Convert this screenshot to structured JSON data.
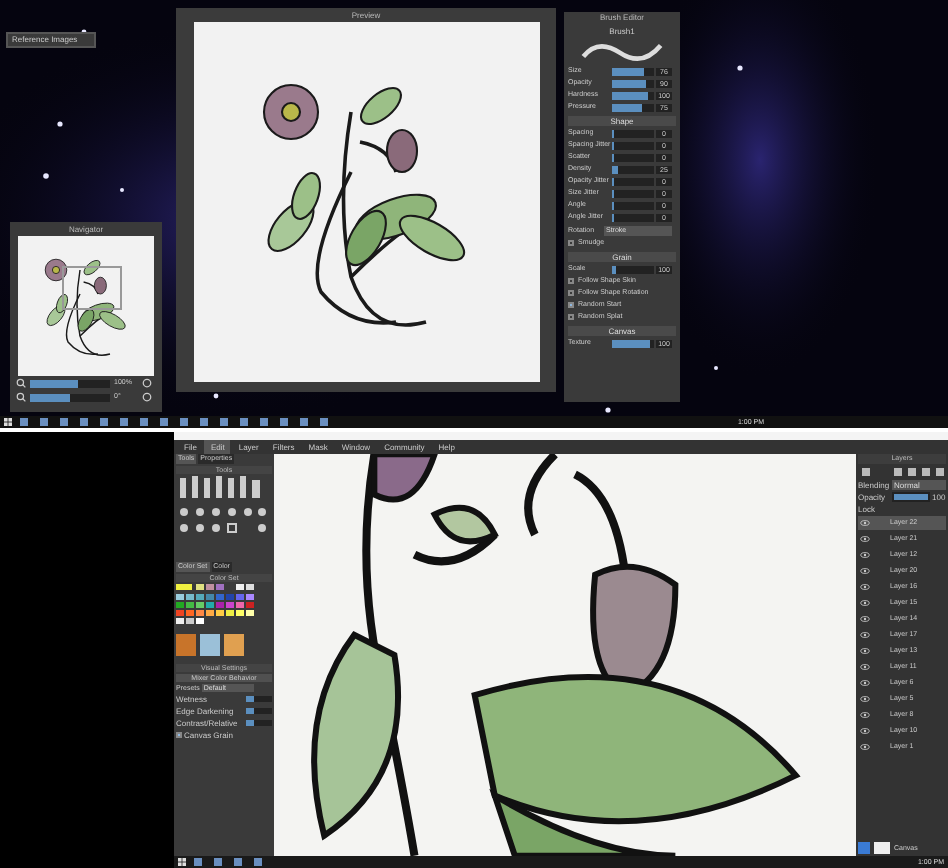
{
  "top_screen": {
    "reference_bar": {
      "title": "Reference Images"
    },
    "preview_window": {
      "title": "Preview"
    },
    "brush_editor": {
      "title": "Brush Editor",
      "preset": "Brush1",
      "items": [
        {
          "kind": "slider",
          "label": "Size",
          "level": 0.75,
          "reading": "76"
        },
        {
          "kind": "slider",
          "label": "Opacity",
          "level": 0.8,
          "reading": "90"
        },
        {
          "kind": "slider",
          "label": "Hardness",
          "level": 0.86,
          "reading": "100"
        },
        {
          "kind": "slider",
          "label": "Pressure",
          "level": 0.72,
          "reading": "75"
        },
        {
          "kind": "header",
          "label": "Shape"
        },
        {
          "kind": "slider",
          "label": "Spacing",
          "level": 0.03,
          "reading": "0"
        },
        {
          "kind": "slider",
          "label": "Spacing Jitter",
          "level": 0.03,
          "reading": "0"
        },
        {
          "kind": "slider",
          "label": "Scatter",
          "level": 0.03,
          "reading": "0"
        },
        {
          "kind": "slider",
          "label": "Density",
          "level": 0.15,
          "reading": "25"
        },
        {
          "kind": "slider",
          "label": "Opacity Jitter",
          "level": 0.03,
          "reading": "0"
        },
        {
          "kind": "slider",
          "label": "Size Jitter",
          "level": 0.03,
          "reading": "0"
        },
        {
          "kind": "slider",
          "label": "Angle",
          "level": 0.03,
          "reading": "0"
        },
        {
          "kind": "slider",
          "label": "Angle Jitter",
          "level": 0.03,
          "reading": "0"
        },
        {
          "kind": "select",
          "label": "Rotation",
          "value": "Stroke"
        },
        {
          "kind": "check",
          "label": "Smudge",
          "checked": false
        },
        {
          "kind": "header",
          "label": "Grain"
        },
        {
          "kind": "slider",
          "label": "Scale",
          "level": 0.1,
          "reading": "100"
        },
        {
          "kind": "check",
          "label": "Follow Shape Skin",
          "checked": false
        },
        {
          "kind": "check",
          "label": "Follow Shape Rotation",
          "checked": false
        },
        {
          "kind": "check",
          "label": "Random Start",
          "checked": true
        },
        {
          "kind": "check",
          "label": "Random Splat",
          "checked": false
        },
        {
          "kind": "header",
          "label": "Canvas"
        },
        {
          "kind": "slider",
          "label": "Texture",
          "level": 0.9,
          "reading": "100"
        }
      ]
    },
    "navigator": {
      "title": "Navigator",
      "zoom": {
        "level": 0.6,
        "reading": "100%"
      },
      "rotation": {
        "level": 0.5,
        "reading": "0°"
      }
    },
    "taskbar": {
      "time": "1:00 PM"
    }
  },
  "app": {
    "menu": [
      {
        "label": "File",
        "selected": false
      },
      {
        "label": "Edit",
        "selected": true
      },
      {
        "label": "Layer",
        "selected": false
      },
      {
        "label": "Filters",
        "selected": false
      },
      {
        "label": "Mask",
        "selected": false
      },
      {
        "label": "Window",
        "selected": false
      },
      {
        "label": "Community",
        "selected": false
      },
      {
        "label": "Help",
        "selected": false
      }
    ],
    "left_panel": {
      "tabs": [
        {
          "label": "Tools",
          "selected": true
        },
        {
          "label": "Properties",
          "selected": false
        }
      ],
      "tools_title": "Tools",
      "color_tabs": [
        {
          "label": "Color Set",
          "selected": true
        },
        {
          "label": "Color",
          "selected": false
        }
      ],
      "color_set_title": "Color Set",
      "settings_title": "Visual Settings",
      "behavior_title": "Mixer Color Behavior",
      "presets": {
        "label": "Presets",
        "value": "Default"
      },
      "sliders": [
        {
          "label": "Wetness",
          "level": 0.3
        },
        {
          "label": "Edge Darkening",
          "level": 0.3
        },
        {
          "label": "Contrast/Relative",
          "level": 0.3
        }
      ],
      "checks": [
        {
          "label": "Canvas Grain",
          "checked": true
        }
      ]
    },
    "layers": {
      "title": "Layers",
      "blending": {
        "label": "Blending",
        "value": "Normal"
      },
      "opacity": {
        "label": "Opacity",
        "level": 1,
        "reading": "100"
      },
      "lock": "Lock",
      "items": [
        {
          "name": "Layer 22",
          "selected": true
        },
        {
          "name": "Layer 21",
          "selected": false
        },
        {
          "name": "Layer 12",
          "selected": false
        },
        {
          "name": "Layer 20",
          "selected": false
        },
        {
          "name": "Layer 16",
          "selected": false
        },
        {
          "name": "Layer 15",
          "selected": false
        },
        {
          "name": "Layer 14",
          "selected": false
        },
        {
          "name": "Layer 17",
          "selected": false
        },
        {
          "name": "Layer 13",
          "selected": false
        },
        {
          "name": "Layer 11",
          "selected": false
        },
        {
          "name": "Layer 6",
          "selected": false
        },
        {
          "name": "Layer 5",
          "selected": false
        },
        {
          "name": "Layer 8",
          "selected": false
        },
        {
          "name": "Layer 10",
          "selected": false
        },
        {
          "name": "Layer 1",
          "selected": false
        }
      ],
      "canvas_label": "Canvas"
    },
    "taskbar": {
      "time": "1:00 PM"
    }
  }
}
